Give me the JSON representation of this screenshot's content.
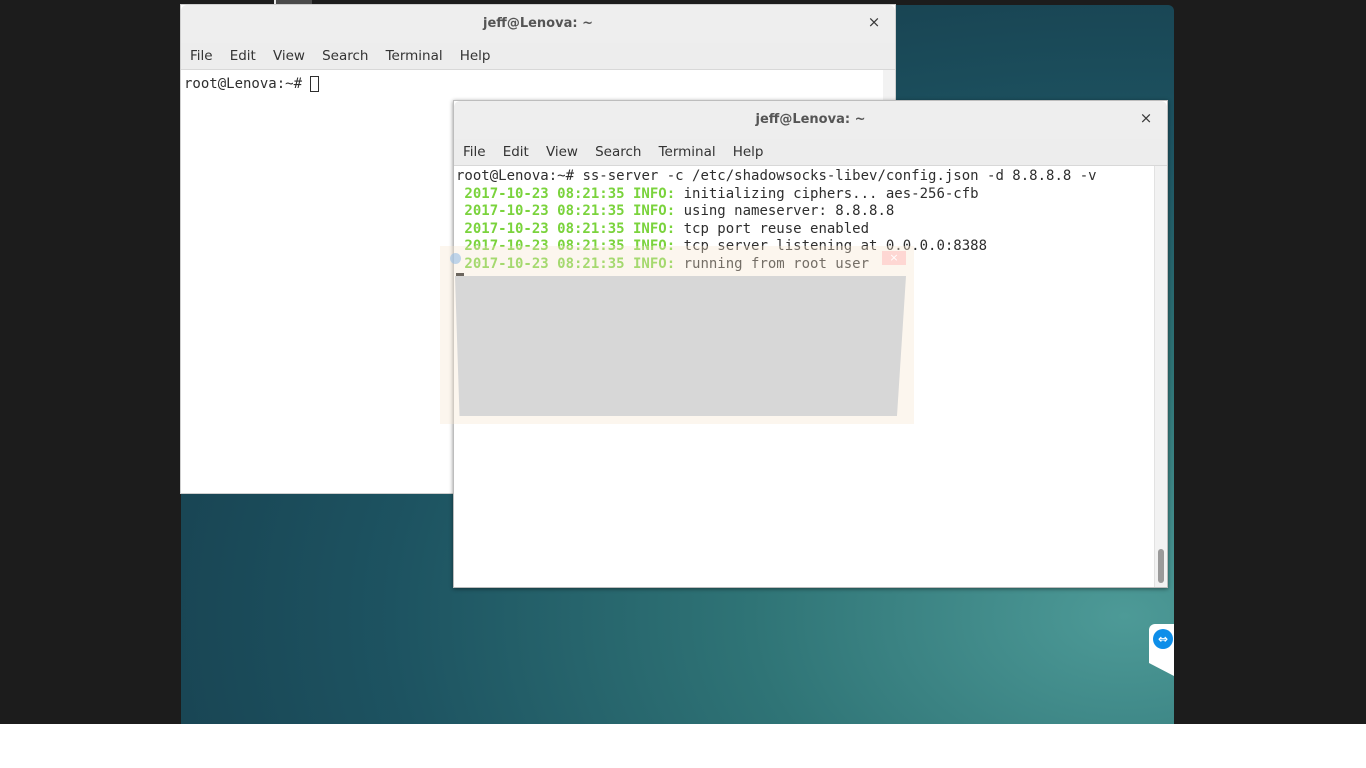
{
  "desktop": {
    "background_colors": [
      "#14394a",
      "#2f7476",
      "#4d9a97"
    ]
  },
  "window_back": {
    "title": "jeff@Lenova: ~",
    "close_glyph": "×",
    "menu": [
      "File",
      "Edit",
      "View",
      "Search",
      "Terminal",
      "Help"
    ],
    "prompt": "root@Lenova:~# "
  },
  "window_front": {
    "title": "jeff@Lenova: ~",
    "close_glyph": "×",
    "menu": [
      "File",
      "Edit",
      "View",
      "Search",
      "Terminal",
      "Help"
    ],
    "command_prompt": "root@Lenova:~# ",
    "command": "ss-server -c /etc/shadowsocks-libev/config.json -d 8.8.8.8 -v",
    "log_lines": [
      {
        "timestamp": " 2017-10-23 08:21:35 INFO:",
        "message": " initializing ciphers... aes-256-cfb"
      },
      {
        "timestamp": " 2017-10-23 08:21:35 INFO:",
        "message": " using nameserver: 8.8.8.8"
      },
      {
        "timestamp": " 2017-10-23 08:21:35 INFO:",
        "message": " tcp port reuse enabled"
      },
      {
        "timestamp": " 2017-10-23 08:21:35 INFO:",
        "message": " tcp server listening at 0.0.0.0:8388"
      },
      {
        "timestamp": " 2017-10-23 08:21:35 INFO:",
        "message": " running from root user"
      }
    ],
    "info_color": "#7ad33c"
  },
  "overlay": {
    "close_glyph": "×"
  },
  "side_tab": {
    "icon": "teamviewer-icon",
    "icon_glyph": "⇔"
  }
}
